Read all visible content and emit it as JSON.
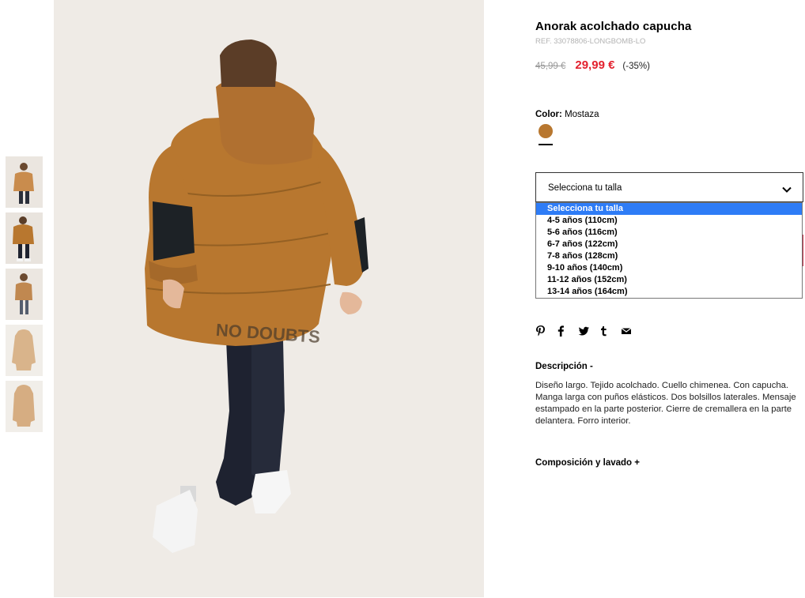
{
  "product": {
    "title": "Anorak acolchado capucha",
    "ref": "REF. 33078806-LONGBOMB-LO",
    "old_price": "45,99 €",
    "price": "29,99 €",
    "discount": "(-35%)"
  },
  "color": {
    "label": "Color:",
    "value": "Mostaza",
    "swatch": "#b8772f"
  },
  "size_select": {
    "label": "Selecciona tu talla",
    "options": [
      "Selecciona tu talla",
      "4-5 años (110cm)",
      "5-6 años (116cm)",
      "6-7 años (122cm)",
      "7-8 años (128cm)",
      "9-10 años (140cm)",
      "11-12 años (152cm)",
      "13-14 años (164cm)"
    ],
    "selected_index": 0
  },
  "share_icons": [
    "pinterest-icon",
    "facebook-icon",
    "twitter-icon",
    "tumblr-icon",
    "email-icon"
  ],
  "description": {
    "title": "Descripción -",
    "text": "Diseño largo. Tejido acolchado. Cuello chimenea. Con capucha. Manga larga con puños elásticos. Dos bolsillos laterales. Mensaje estampado en la parte posterior. Cierre de cremallera en la parte delantera. Forro interior."
  },
  "composition": {
    "title": "Composición y lavado +"
  },
  "colors": {
    "accent": "#e3212e",
    "jacket": "#b8772f",
    "highlight": "#2e7cf6"
  }
}
